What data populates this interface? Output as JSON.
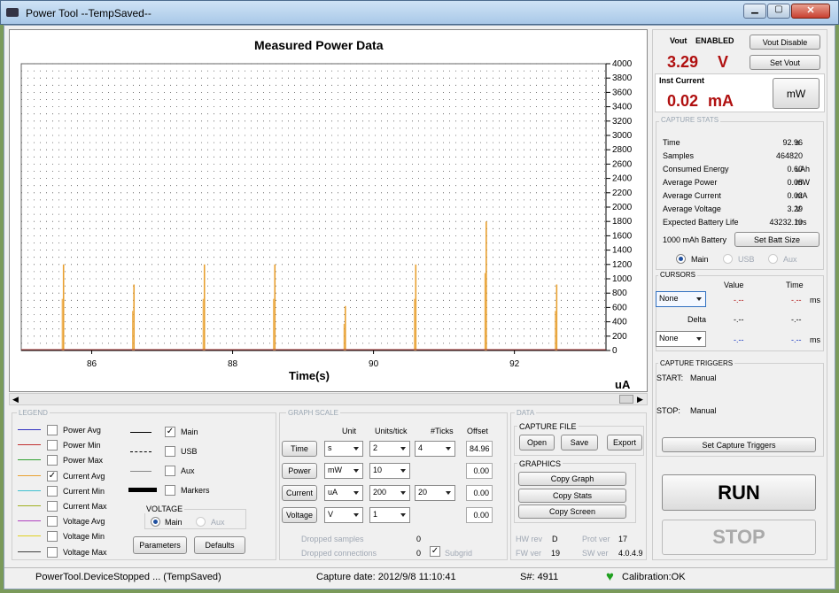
{
  "window": {
    "title": "Power Tool --TempSaved--"
  },
  "vout": {
    "label": "Vout",
    "status": "ENABLED",
    "value": "3.29",
    "unit": "V",
    "disable_btn": "Vout Disable",
    "set_btn": "Set Vout"
  },
  "inst": {
    "label": "Inst Current",
    "value": "0.02",
    "unit": "mA",
    "toggle_btn": "mW"
  },
  "stats": {
    "title": "CAPTURE STATS",
    "rows": [
      {
        "label": "Time",
        "value": "92.96",
        "unit": "s"
      },
      {
        "label": "Samples",
        "value": "464820",
        "unit": ""
      },
      {
        "label": "Consumed Energy",
        "value": "0.60",
        "unit": "uAh"
      },
      {
        "label": "Average Power",
        "value": "0.08",
        "unit": "mW"
      },
      {
        "label": "Average Current",
        "value": "0.02",
        "unit": "mA"
      },
      {
        "label": "Average Voltage",
        "value": "3.29",
        "unit": "V"
      },
      {
        "label": "Expected Battery Life",
        "value": "43232.10",
        "unit": "hrs"
      }
    ],
    "battery": "1000   mAh Battery",
    "batt_btn": "Set Batt Size",
    "radios": [
      "Main",
      "USB",
      "Aux"
    ]
  },
  "cursors": {
    "title": "CURSORS",
    "value_hdr": "Value",
    "time_hdr": "Time",
    "sel1": "None",
    "sel2": "None",
    "delta": "Delta",
    "dash": "-.--",
    "ms": "ms"
  },
  "triggers": {
    "title": "CAPTURE TRIGGERS",
    "start_lbl": "START:",
    "start_val": "Manual",
    "stop_lbl": "STOP:",
    "stop_val": "Manual",
    "btn": "Set Capture Triggers"
  },
  "run": "RUN",
  "stop": "STOP",
  "chart_data": {
    "type": "line",
    "title": "Measured Power Data",
    "xlabel": "Time(s)",
    "ylabel": "uA",
    "xlim": [
      85.0,
      93.3
    ],
    "ylim": [
      0,
      4000
    ],
    "xticks": [
      "86",
      "88",
      "90",
      "92"
    ],
    "yticks": [
      "0",
      "200",
      "400",
      "600",
      "800",
      "1000",
      "1200",
      "1400",
      "1600",
      "1800",
      "2000",
      "2200",
      "2400",
      "2600",
      "2800",
      "3000",
      "3200",
      "3400",
      "3600",
      "3800",
      "4000"
    ],
    "spikes": [
      [
        85.6,
        1200
      ],
      [
        86.6,
        920
      ],
      [
        87.6,
        1200
      ],
      [
        88.6,
        1200
      ],
      [
        89.6,
        620
      ],
      [
        90.6,
        1200
      ],
      [
        91.6,
        1800
      ],
      [
        92.6,
        920
      ]
    ],
    "color": "#e8a030"
  },
  "legend": {
    "title": "LEGEND",
    "items": [
      {
        "label": "Power Avg",
        "color": "#3030c0",
        "checked": false
      },
      {
        "label": "Power Min",
        "color": "#c03030",
        "checked": false
      },
      {
        "label": "Power Max",
        "color": "#30a030",
        "checked": false
      },
      {
        "label": "Current Avg",
        "color": "#e8a030",
        "checked": true
      },
      {
        "label": "Current Min",
        "color": "#40c0d0",
        "checked": false
      },
      {
        "label": "Current Max",
        "color": "#a0b020",
        "checked": false
      },
      {
        "label": "Voltage Avg",
        "color": "#b040c0",
        "checked": false
      },
      {
        "label": "Voltage Min",
        "color": "#e0d020",
        "checked": false
      },
      {
        "label": "Voltage Max",
        "color": "#404040",
        "checked": false
      }
    ],
    "lines": [
      {
        "label": "Main",
        "checked": true
      },
      {
        "label": "USB",
        "checked": false
      },
      {
        "label": "Aux",
        "checked": false
      },
      {
        "label": "Markers",
        "checked": false
      }
    ],
    "voltage": "VOLTAGE",
    "v_main": "Main",
    "v_aux": "Aux",
    "params_btn": "Parameters",
    "defaults_btn": "Defaults"
  },
  "scale": {
    "title": "GRAPH SCALE",
    "hdr_unit": "Unit",
    "hdr_upt": "Units/tick",
    "hdr_ticks": "#Ticks",
    "hdr_off": "Offset",
    "rows": [
      {
        "label": "Time",
        "unit": "s",
        "upt": "2",
        "ticks": "4",
        "offset": "84.96"
      },
      {
        "label": "Power",
        "unit": "mW",
        "upt": "10",
        "ticks": "",
        "offset": "0.00"
      },
      {
        "label": "Current",
        "unit": "uA",
        "upt": "200",
        "ticks": "20",
        "offset": "0.00"
      },
      {
        "label": "Voltage",
        "unit": "V",
        "upt": "1",
        "ticks": "",
        "offset": "0.00"
      }
    ],
    "dropped_samples": "Dropped samples",
    "ds_val": "0",
    "dropped_conn": "Dropped connections",
    "dc_val": "0",
    "subgrid": "Subgrid"
  },
  "data": {
    "title": "DATA",
    "capture_file": "CAPTURE FILE",
    "open": "Open",
    "save": "Save",
    "export": "Export",
    "graphics": "GRAPHICS",
    "copy_graph": "Copy Graph",
    "copy_stats": "Copy Stats",
    "copy_screen": "Copy Screen",
    "hw_lbl": "HW rev",
    "hw": "D",
    "prot_lbl": "Prot ver",
    "prot": "17",
    "fw_lbl": "FW ver",
    "fw": "19",
    "sw_lbl": "SW ver",
    "sw": "4.0.4.9"
  },
  "status": {
    "device": "PowerTool.DeviceStopped ... (TempSaved)",
    "capture_date": "Capture date: 2012/9/8 11:10:41",
    "serial": "S#: 4911",
    "calibration": "Calibration:OK"
  }
}
